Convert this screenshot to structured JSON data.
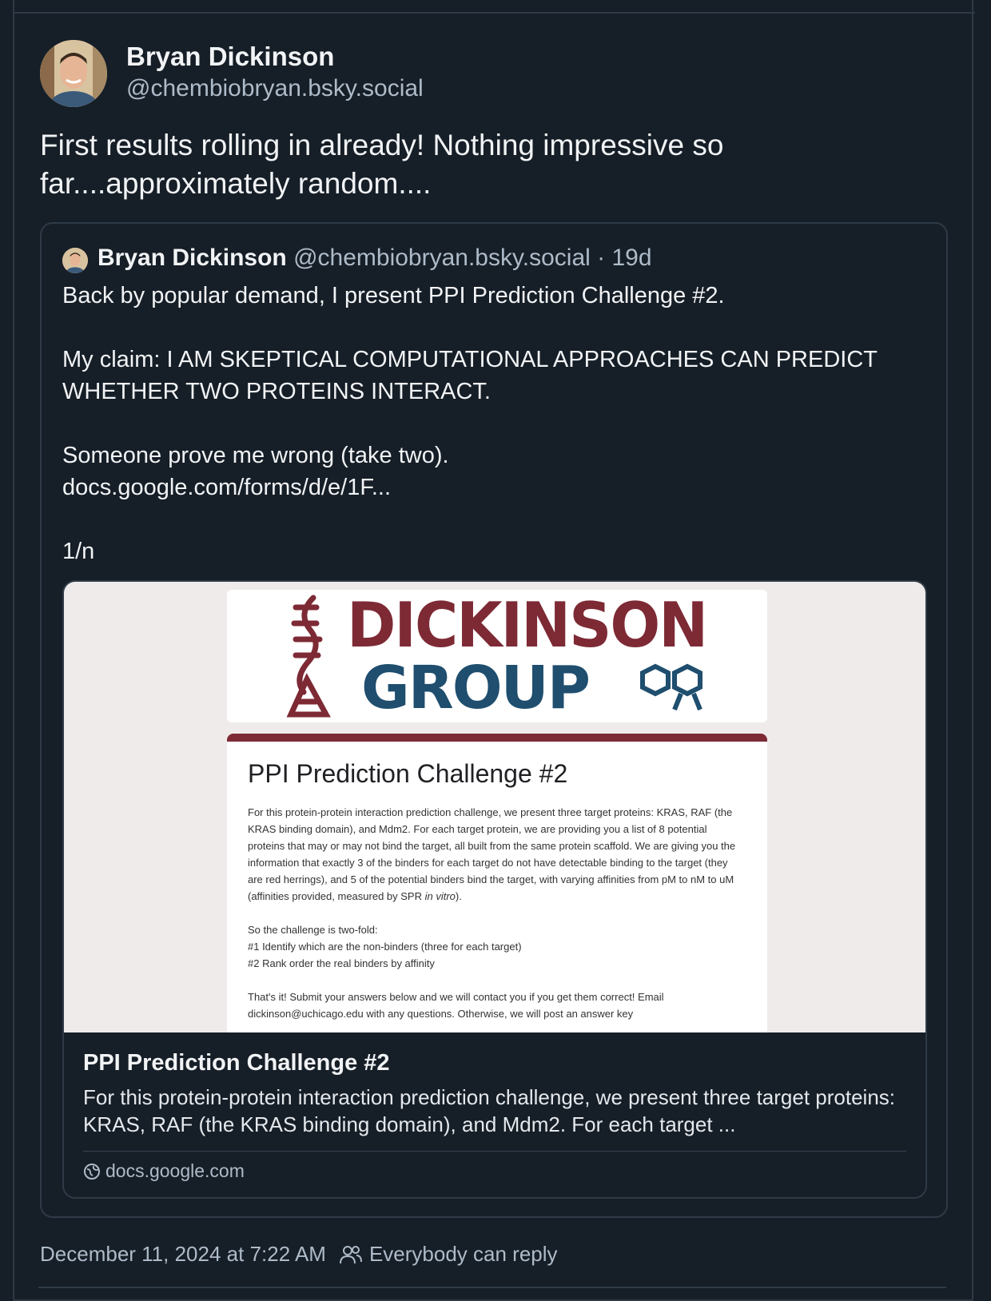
{
  "post": {
    "author_name": "Bryan Dickinson",
    "author_handle": "@chembiobryan.bsky.social",
    "text_line1": "First results rolling in already! Nothing impressive so",
    "text_line2": "far....approximately random...."
  },
  "quote": {
    "author_name": "Bryan Dickinson",
    "author_handle": "@chembiobryan.bsky.social",
    "time_ago": "· 19d",
    "lines": [
      "Back by popular demand, I present PPI Prediction Challenge #2.",
      "My claim: I AM SKEPTICAL COMPUTATIONAL APPROACHES CAN PREDICT WHETHER TWO PROTEINS INTERACT.",
      "Someone prove me wrong (take two).",
      "docs.google.com/forms/d/e/1F...",
      "1/n"
    ]
  },
  "link_card": {
    "image": {
      "logo_line1": "DICKINSON",
      "logo_line2": "GROUP",
      "form_title": "PPI Prediction Challenge #2",
      "form_para1": "For this protein-protein interaction prediction challenge, we present three target proteins: KRAS, RAF (the KRAS binding domain), and Mdm2. For each target protein, we are providing you a list of 8 potential proteins that may or may not bind the target, all built from the same protein scaffold. We are giving you the information that exactly 3 of the binders for each target do not have detectable binding to the target (they are red herrings), and 5 of the potential binders bind the target, with varying affinities from pM to nM to uM (affinities provided, measured by SPR",
      "form_para1_italic": "in vitro",
      "form_para1_end": ").",
      "form_list_intro": "So the challenge is two-fold:",
      "form_item1": "#1 Identify which are the non-binders (three for each target)",
      "form_item2": "#2 Rank order the real binders by affinity",
      "form_para2": "That's it! Submit your answers below and we will contact you if you get them correct! Email dickinson@uchicago.edu with any questions. Otherwise, we will post an answer key"
    },
    "title": "PPI Prediction Challenge #2",
    "description": "For this protein-protein interaction prediction challenge, we present three target proteins: KRAS, RAF (the KRAS binding domain), and Mdm2. For each target ...",
    "domain": "docs.google.com"
  },
  "footer": {
    "timestamp": "December 11, 2024 at 7:22 AM",
    "reply_setting": "Everybody can reply"
  },
  "colors": {
    "background": "#161e27",
    "border": "#2e3a47",
    "muted_text": "#aebbc9",
    "logo_red": "#7d2a35",
    "logo_blue": "#1f4e6e"
  },
  "icons": {
    "globe": "globe-icon",
    "people": "people-icon"
  }
}
